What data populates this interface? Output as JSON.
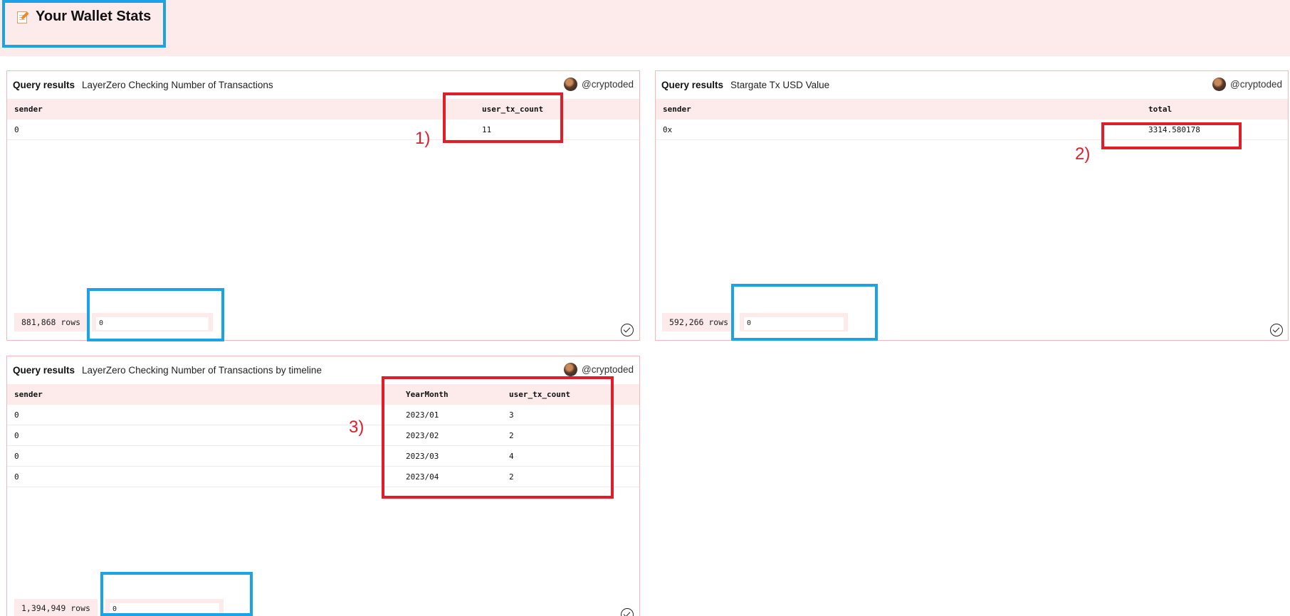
{
  "page": {
    "title": "Your Wallet Stats",
    "title_icon": "memo-icon"
  },
  "panels": [
    {
      "label": "Query results",
      "name": "LayerZero Checking Number of Transactions",
      "author": "@cryptoded",
      "columns": [
        "sender",
        "user_tx_count"
      ],
      "rows": [
        {
          "sender": "0",
          "value": "11"
        }
      ],
      "row_count": "881,868 rows",
      "search_value": "0"
    },
    {
      "label": "Query results",
      "name": "Stargate Tx USD Value",
      "author": "@cryptoded",
      "columns": [
        "sender",
        "total"
      ],
      "rows": [
        {
          "sender": "0x",
          "value": "3314.580178"
        }
      ],
      "row_count": "592,266 rows",
      "search_value": "0"
    },
    {
      "label": "Query results",
      "name": "LayerZero Checking Number of Transactions by timeline",
      "author": "@cryptoded",
      "columns": [
        "sender",
        "YearMonth",
        "user_tx_count"
      ],
      "rows": [
        {
          "sender": "0",
          "month": "2023/01",
          "value": "3"
        },
        {
          "sender": "0",
          "month": "2023/02",
          "value": "2"
        },
        {
          "sender": "0",
          "month": "2023/03",
          "value": "4"
        },
        {
          "sender": "0",
          "month": "2023/04",
          "value": "2"
        }
      ],
      "row_count": "1,394,949 rows",
      "search_value": "0"
    }
  ],
  "annotations": {
    "mark1": "1)",
    "mark2": "2)",
    "mark3": "3)"
  },
  "colors": {
    "accent_red": "#e01e2a",
    "accent_blue": "#1aa3e6",
    "header_bg": "#fdeaea"
  }
}
